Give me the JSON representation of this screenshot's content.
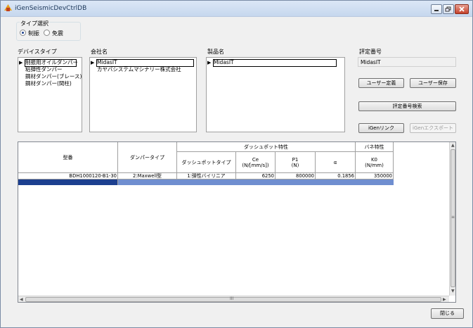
{
  "window": {
    "title": "iGenSeismicDevCtrlDB"
  },
  "type_select": {
    "label": "タイプ選択",
    "options": [
      "制振",
      "免震"
    ],
    "selected": "制振"
  },
  "device_type": {
    "label": "デバイスタイプ",
    "items": [
      "制振用オイルダンパー",
      "粘弾性ダンパー",
      "鋼材ダンパー(ブレース)",
      "鋼材ダンパー(間柱)"
    ]
  },
  "company": {
    "label": "会社名",
    "items": [
      "MidasIT",
      "カヤバシステムマシナリー株式会社"
    ]
  },
  "product": {
    "label": "製品名",
    "items": [
      "MidasIT"
    ]
  },
  "cert": {
    "label": "評定番号",
    "value": "MidasIT"
  },
  "buttons": {
    "user_define": "ユーザー定義",
    "user_save": "ユーザー保存",
    "cert_search": "評定番号検索",
    "igen_link": "iGenリンク",
    "igen_export": "iGenエクスポート",
    "close": "閉じる"
  },
  "table": {
    "headers": {
      "model": "型番",
      "damper_type": "ダンパータイプ",
      "dashpot_group": "ダッシュポット特性",
      "spring_group": "バネ特性",
      "dashpot_type": "ダッシュポットタイプ",
      "ce": "Ce",
      "ce_unit": "(N/[mm/s])",
      "p1": "P1",
      "p1_unit": "(N)",
      "alpha": "α",
      "k0": "K0",
      "k0_unit": "(N/mm)"
    },
    "rows": [
      {
        "model": "BDH1000120-B1-30",
        "damper_type": "2:Maxwell型",
        "dashpot_type": "1:弾性バイリニア",
        "ce": "6250",
        "p1": "800000",
        "alpha": "0.1856",
        "k0": "350000"
      }
    ]
  },
  "scroll": {
    "hthumb_glyph": "III",
    "vthumb_glyph": "≡"
  }
}
